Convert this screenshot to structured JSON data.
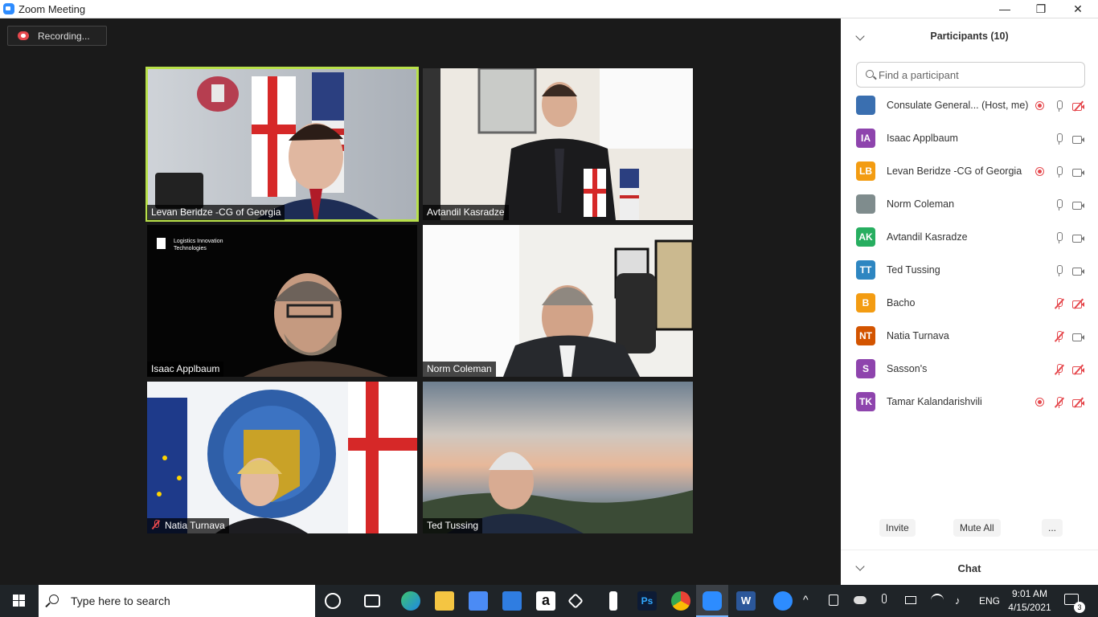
{
  "window": {
    "title": "Zoom Meeting",
    "minimize_glyph": "—",
    "maximize_glyph": "❐",
    "close_glyph": "✕"
  },
  "recording": {
    "label": "Recording..."
  },
  "tiles": [
    {
      "name": "Levan Beridze -CG of Georgia",
      "active": true,
      "muted": false
    },
    {
      "name": "Avtandil Kasradze",
      "active": false,
      "muted": false
    },
    {
      "name": "Isaac Applbaum",
      "active": false,
      "muted": false
    },
    {
      "name": "Norm Coleman",
      "active": false,
      "muted": false
    },
    {
      "name": "Natia Turnava",
      "active": false,
      "muted": true
    },
    {
      "name": "Ted Tussing",
      "active": false,
      "muted": false
    }
  ],
  "tile_logo_text": [
    "Logistics Innovation",
    "Technologies"
  ],
  "participants_panel": {
    "title": "Participants (10)",
    "search_placeholder": "Find a participant",
    "participants": [
      {
        "initials": "",
        "name": "Consulate General... (Host, me)",
        "avatar_color": "#3a6fb0",
        "recording": true,
        "mic": "on",
        "video": "off"
      },
      {
        "initials": "IA",
        "name": "Isaac Applbaum",
        "avatar_color": "#8e44ad",
        "recording": false,
        "mic": "on",
        "video": "on"
      },
      {
        "initials": "LB",
        "name": "Levan Beridze -CG of Georgia",
        "avatar_color": "#f39c12",
        "recording": true,
        "mic": "speaking",
        "video": "on"
      },
      {
        "initials": "",
        "name": "Norm Coleman",
        "avatar_color": "#7f8c8d",
        "recording": false,
        "mic": "on",
        "video": "on"
      },
      {
        "initials": "AK",
        "name": "Avtandil Kasradze",
        "avatar_color": "#27ae60",
        "recording": false,
        "mic": "on",
        "video": "on"
      },
      {
        "initials": "TT",
        "name": "Ted Tussing",
        "avatar_color": "#2e86c1",
        "recording": false,
        "mic": "on",
        "video": "on"
      },
      {
        "initials": "B",
        "name": "Bacho",
        "avatar_color": "#f39c12",
        "recording": false,
        "mic": "off",
        "video": "off"
      },
      {
        "initials": "NT",
        "name": "Natia Turnava",
        "avatar_color": "#d35400",
        "recording": false,
        "mic": "off",
        "video": "on"
      },
      {
        "initials": "S",
        "name": "Sasson's",
        "avatar_color": "#8e44ad",
        "recording": false,
        "mic": "off",
        "video": "off"
      },
      {
        "initials": "TK",
        "name": "Tamar Kalandarishvili",
        "avatar_color": "#8e44ad",
        "recording": true,
        "mic": "off",
        "video": "off"
      }
    ],
    "invite_label": "Invite",
    "mute_all_label": "Mute All",
    "more_label": "...",
    "chat_title": "Chat"
  },
  "taskbar": {
    "search_placeholder": "Type here to search",
    "apps": [
      "cortana-icon",
      "task-view-icon",
      "edge-icon",
      "file-explorer-icon",
      "store-icon",
      "mail-icon",
      "amazon-icon",
      "dropbox-icon",
      "app-icon",
      "photoshop-icon",
      "chrome-icon",
      "zoom-icon",
      "word-icon"
    ],
    "photoshop_label": "Ps",
    "word_label": "W",
    "amazon_label": "a",
    "language": "ENG",
    "time": "9:01 AM",
    "date": "4/15/2021",
    "notification_count": "3"
  }
}
